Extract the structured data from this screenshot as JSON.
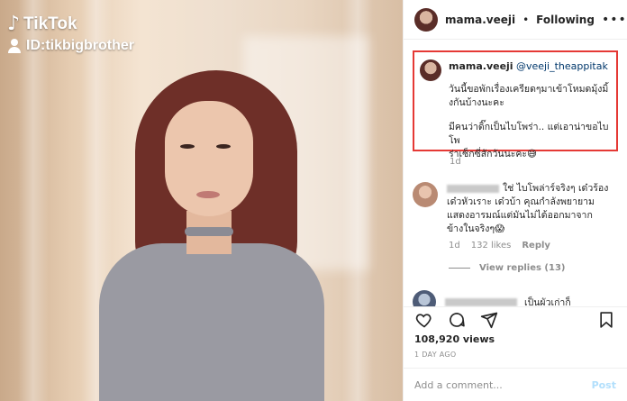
{
  "media": {
    "watermark_brand": "TikTok",
    "watermark_id": "ID:tikbigbrother",
    "icons": [
      "tiktok-note-icon",
      "person-icon"
    ]
  },
  "post": {
    "username": "mama.veeji",
    "separator": "•",
    "follow_status": "Following",
    "more": "•••",
    "caption": {
      "username": "mama.veeji",
      "mention": "@veeji_theappitak",
      "line1": "วันนี้ขอพักเรื่องเครียดๆมาเข้าโหมดมุ้งมิ้",
      "line2": "งกันบ้างนะคะ",
      "line3": "มีคนว่าดิ๊กเป็นไบโพร่า.. แต่เอาน่าขอไบโพ",
      "line4": "ร่าเซ็กซี่สักวันนะคะ😅",
      "date": "1d"
    },
    "comments": [
      {
        "text1": "ใช่ ไบโพล่าร์จริงๆ เด๋วร้อง",
        "text2": "เด๋วหัวเราะ เด๋วบ้า คุณกำลังพยายาม",
        "text3": "แสดงอารมณ์แต่มันไม่ได้ออกมาจาก",
        "text4": "ข้างในจริงๆ😱",
        "age": "1d",
        "likes": "132 likes",
        "reply": "Reply",
        "view_replies": "View replies (13)"
      },
      {
        "text1": "เป็นผัวเก่าก็"
      }
    ],
    "views": "108,920 views",
    "time_ago": "1 DAY AGO",
    "add_comment_placeholder": "Add a comment...",
    "post_button": "Post"
  },
  "colors": {
    "highlight_box": "#e53935",
    "text_primary": "#262626",
    "text_secondary": "#8e8e8e",
    "mention": "#00376b",
    "post_disabled": "#b2dffc"
  }
}
